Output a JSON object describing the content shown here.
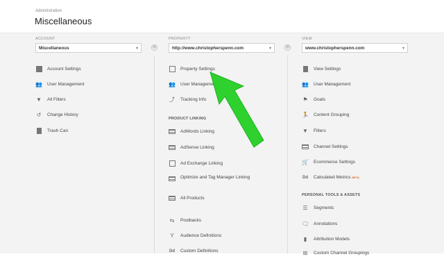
{
  "header": {
    "breadcrumb": "Administration",
    "title": "Miscellaneous"
  },
  "account": {
    "label": "ACCOUNT",
    "selected": "Miscellaneous",
    "items": [
      {
        "label": "Account Settings",
        "icon": "building-icon"
      },
      {
        "label": "User Management",
        "icon": "users-icon"
      },
      {
        "label": "All Filters",
        "icon": "filter-icon"
      },
      {
        "label": "Change History",
        "icon": "history-icon"
      },
      {
        "label": "Trash Can",
        "icon": "trash-icon"
      }
    ]
  },
  "property": {
    "label": "PROPERTY",
    "selected": "http://www.christopherspenn.com",
    "items": [
      {
        "label": "Property Settings",
        "icon": "property-icon"
      },
      {
        "label": "User Management",
        "icon": "users-icon"
      },
      {
        "label": "Tracking Info",
        "icon": "tracking-icon"
      }
    ],
    "product_linking_label": "PRODUCT LINKING",
    "linking_items": [
      {
        "label": "AdWords Linking",
        "icon": "adwords-icon"
      },
      {
        "label": "AdSense Linking",
        "icon": "adsense-icon"
      },
      {
        "label": "Ad Exchange Linking",
        "icon": "adexchange-icon"
      },
      {
        "label": "Optimize and Tag Manager Linking",
        "icon": "optimize-icon"
      },
      {
        "label": "All Products",
        "icon": "all-products-icon"
      }
    ],
    "more_items": [
      {
        "label": "Postbacks",
        "icon": "postbacks-icon"
      },
      {
        "label": "Audience Definitions",
        "icon": "audience-icon"
      },
      {
        "label": "Custom Definitions",
        "icon": "custom-definitions-icon"
      }
    ]
  },
  "view": {
    "label": "VIEW",
    "selected": "www.christopherspenn.com",
    "items": [
      {
        "label": "View Settings",
        "icon": "document-icon"
      },
      {
        "label": "User Management",
        "icon": "users-icon"
      },
      {
        "label": "Goals",
        "icon": "flag-icon"
      },
      {
        "label": "Content Grouping",
        "icon": "person-icon"
      },
      {
        "label": "Filters",
        "icon": "filter-icon"
      },
      {
        "label": "Channel Settings",
        "icon": "channel-icon"
      },
      {
        "label": "Ecommerce Settings",
        "icon": "cart-icon"
      },
      {
        "label": "Calculated Metrics",
        "icon": "calculated-icon",
        "badge": "BETA"
      }
    ],
    "personal_label": "PERSONAL TOOLS & ASSETS",
    "personal_items": [
      {
        "label": "Segments",
        "icon": "segments-icon"
      },
      {
        "label": "Annotations",
        "icon": "annotations-icon"
      },
      {
        "label": "Attribution Models",
        "icon": "attribution-icon"
      },
      {
        "label": "Custom Channel Groupings",
        "icon": "grouping-icon"
      }
    ]
  },
  "icons": {
    "caret": "▾",
    "link_circle": "⊕",
    "dd_glyph": "Dd"
  },
  "colors": {
    "arrow": "#2ed12e",
    "beta_badge": "#e06d2a"
  }
}
